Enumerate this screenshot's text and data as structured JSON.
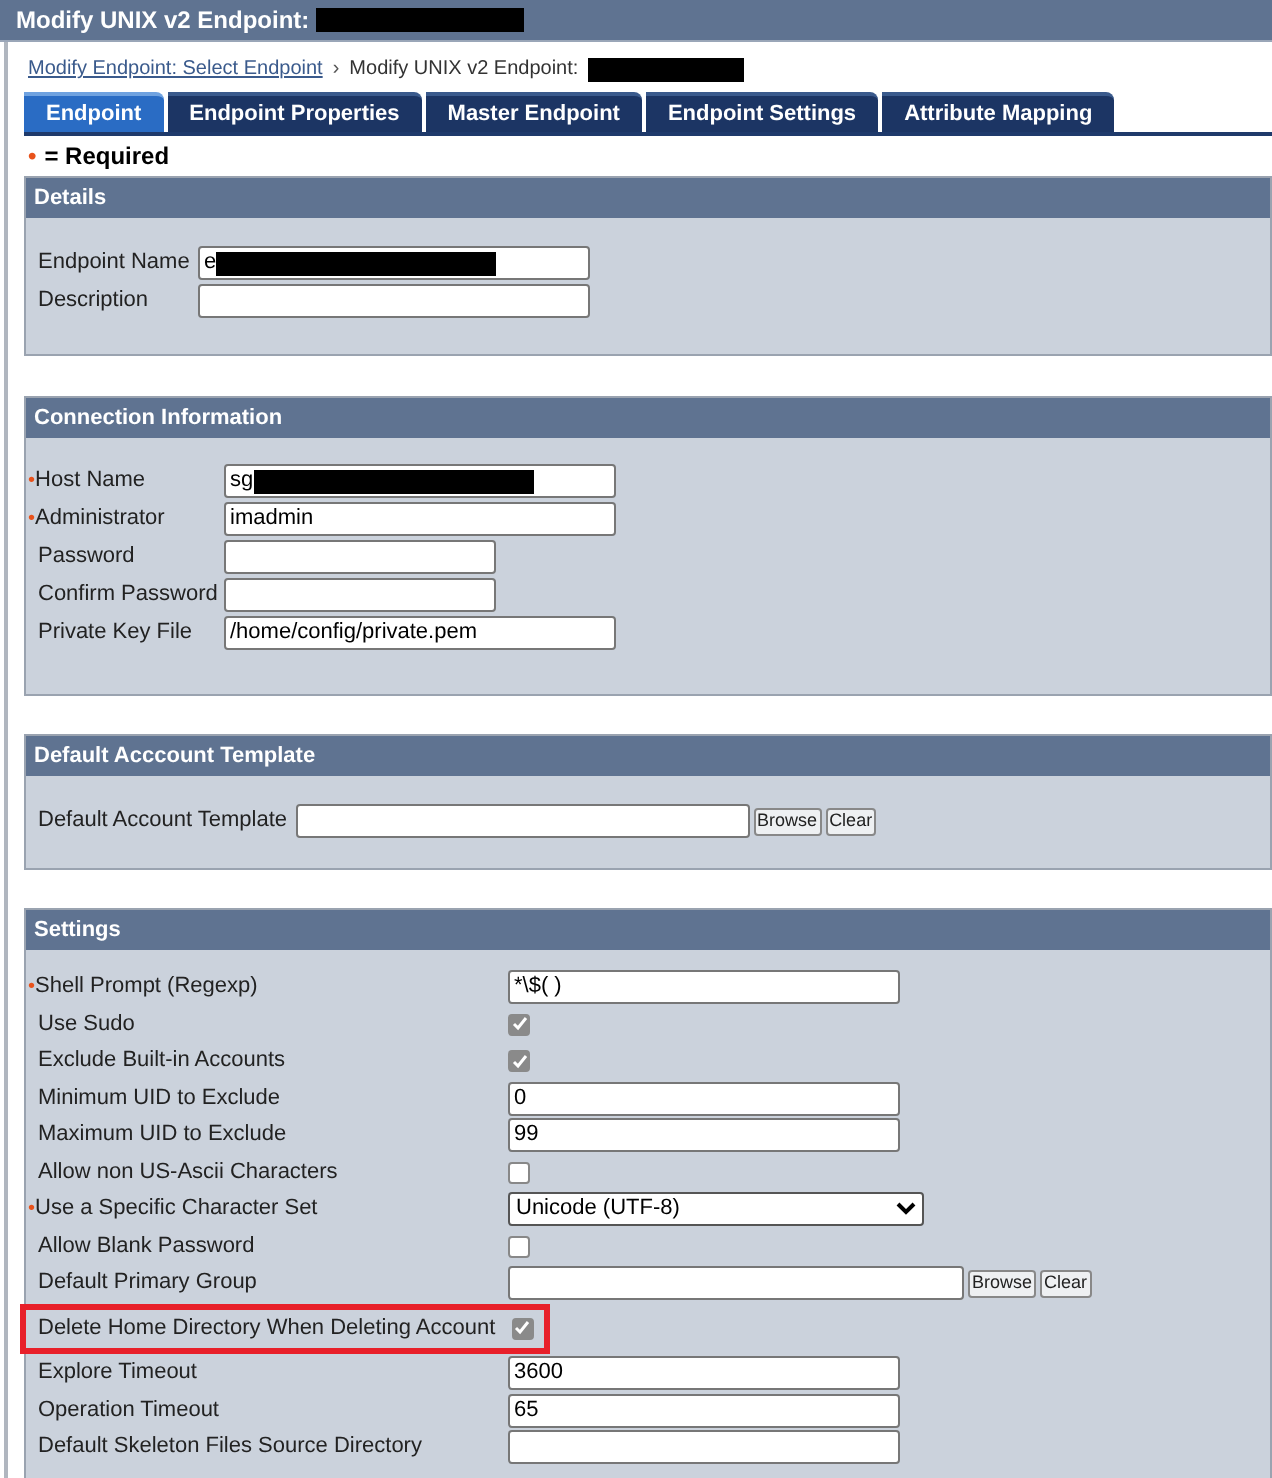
{
  "window": {
    "title": "Modify UNIX v2 Endpoint:",
    "title_redacted": true
  },
  "breadcrumb": [
    {
      "label": "Modify Endpoint: Select Endpoint",
      "kind": "link"
    },
    {
      "label": "Modify UNIX v2 Endpoint:",
      "kind": "text",
      "redacted": true
    }
  ],
  "separator": "›",
  "tabs": [
    {
      "label": "Endpoint",
      "selected": true
    },
    {
      "label": "Endpoint Properties",
      "selected": false
    },
    {
      "label": "Master Endpoint",
      "selected": false
    },
    {
      "label": "Endpoint Settings",
      "selected": false
    },
    {
      "label": "Attribute Mapping",
      "selected": false
    }
  ],
  "required_note": {
    "mark": "•",
    "text": "= Required"
  },
  "sections": [
    {
      "title": "Details",
      "rows": [
        {
          "label": "Endpoint Name",
          "kind": "text",
          "value": "e",
          "redacted": true
        },
        {
          "label": "Description",
          "kind": "text",
          "value": ""
        }
      ]
    },
    {
      "title": "Connection Information",
      "rows": [
        {
          "marker": "•",
          "label": "Host Name",
          "kind": "text",
          "value": "sg",
          "redacted": true
        },
        {
          "marker": "•",
          "label": "Administrator",
          "kind": "text",
          "value": "imadmin"
        },
        {
          "label": "Password",
          "kind": "password",
          "value": ""
        },
        {
          "label": "Confirm Password",
          "kind": "password",
          "value": ""
        },
        {
          "label": "Private Key File",
          "kind": "text",
          "value": "/home/config/private.pem"
        }
      ]
    },
    {
      "title": "Default Acccount Template",
      "rows": [
        {
          "label": "Default Account Template",
          "kind": "browse",
          "value": "",
          "buttons": [
            "Browse",
            "Clear"
          ]
        }
      ]
    },
    {
      "title": "Settings",
      "rows": [
        {
          "marker": "•",
          "label": "Shell Prompt (Regexp)",
          "kind": "text",
          "value": "*\\$( )"
        },
        {
          "label": "Use Sudo",
          "kind": "checkbox",
          "checked": true
        },
        {
          "label": "Exclude Built-in Accounts",
          "kind": "checkbox",
          "checked": true
        },
        {
          "label": "Minimum UID to Exclude",
          "kind": "text",
          "value": "0"
        },
        {
          "label": "Maximum UID to Exclude",
          "kind": "text",
          "value": "99"
        },
        {
          "label": "Allow non US-Ascii Characters",
          "kind": "checkbox",
          "checked": false
        },
        {
          "marker": "•",
          "label": "Use a Specific Character Set",
          "kind": "select",
          "value": "Unicode (UTF-8)"
        },
        {
          "label": "Allow Blank Password",
          "kind": "checkbox",
          "checked": false
        },
        {
          "label": "Default Primary Group",
          "kind": "browse",
          "value": "",
          "buttons": [
            "Browse",
            "Clear"
          ]
        },
        {
          "label": "Delete Home Directory When Deleting Account",
          "kind": "checkbox",
          "checked": true,
          "highlighted": true
        },
        {
          "label": "Explore Timeout",
          "kind": "text",
          "value": "3600"
        },
        {
          "label": "Operation Timeout",
          "kind": "text",
          "value": "65"
        },
        {
          "label": "Default Skeleton Files Source Directory",
          "kind": "text",
          "value": ""
        }
      ]
    }
  ]
}
